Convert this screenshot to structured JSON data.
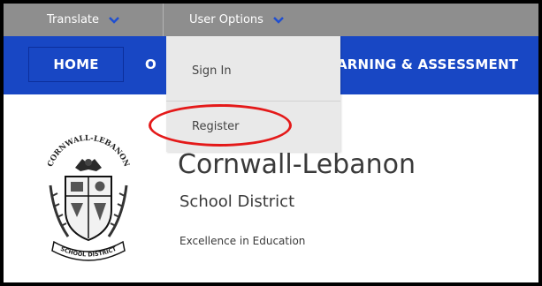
{
  "topbar": {
    "translate_label": "Translate",
    "user_options_label": "User Options"
  },
  "nav": {
    "home": "HOME",
    "item2_partial": "O",
    "item3_partial": "ARNING & ASSESSMENT"
  },
  "dropdown": {
    "items": [
      {
        "label": "Sign In"
      },
      {
        "label": "Register"
      }
    ]
  },
  "logo": {
    "arc_text": "CORNWALL-LEBANON",
    "banner_text": "SCHOOL DISTRICT"
  },
  "school": {
    "name": "Cornwall-Lebanon",
    "subtitle": "School District",
    "tagline": "Excellence in Education"
  },
  "colors": {
    "topbar": "#8e8e8e",
    "navbar": "#1847c4",
    "dropdown": "#e9e9e9",
    "highlight_circle": "#e41919"
  },
  "icons": {
    "translate_chevron": "chevron-down-icon",
    "user_options_chevron": "chevron-down-icon",
    "logo": "seal-logo-icon"
  }
}
